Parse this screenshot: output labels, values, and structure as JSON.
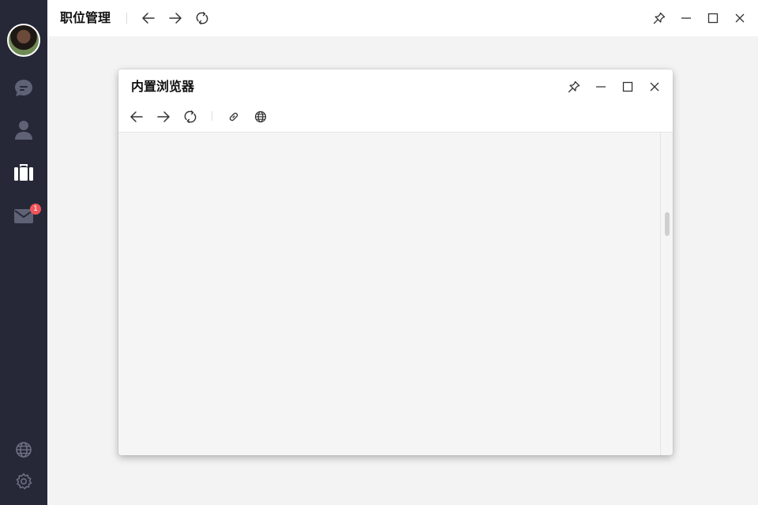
{
  "app": {
    "title": "职位管理"
  },
  "sidebar": {
    "items": [
      {
        "name": "messages",
        "icon": "chat-icon",
        "active": false
      },
      {
        "name": "contacts",
        "icon": "user-icon",
        "active": false
      },
      {
        "name": "jobs",
        "icon": "briefcase-icon",
        "active": true
      },
      {
        "name": "mail",
        "icon": "mail-icon",
        "active": false,
        "badge": "1"
      }
    ],
    "bottom": [
      {
        "name": "language",
        "icon": "globe-icon"
      },
      {
        "name": "settings",
        "icon": "gear-icon"
      }
    ]
  },
  "browser": {
    "title": "内置浏览器"
  },
  "colors": {
    "sidebar_bg": "#262838",
    "sidebar_icon": "#5f6274",
    "sidebar_icon_active": "#ffffff",
    "badge": "#f0555a",
    "background": "#f3f3f3"
  }
}
